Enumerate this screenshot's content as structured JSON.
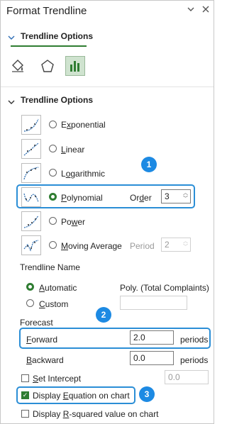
{
  "panel": {
    "title": "Format Trendline",
    "collapse_icon": "chevron-down-icon",
    "close_icon": "close-icon"
  },
  "tabs": {
    "active_label": "Trendline Options",
    "categories": [
      "fill-line-icon",
      "effects-pentagon-icon",
      "trendline-options-bar-icon"
    ]
  },
  "section": {
    "label": "Trendline Options"
  },
  "types": [
    {
      "label_pre": "",
      "label_u": "x",
      "label_post": "ponential",
      "icon": "exponential-curve-icon"
    },
    {
      "label_pre": "",
      "label_u": "L",
      "label_post": "inear",
      "icon": "linear-line-icon"
    },
    {
      "label_pre": "L",
      "label_u": "o",
      "label_post": "garithmic",
      "icon": "logarithmic-curve-icon"
    },
    {
      "label_pre": "",
      "label_u": "P",
      "label_post": "olynomial",
      "icon": "polynomial-curve-icon"
    },
    {
      "label_pre": "Po",
      "label_u": "w",
      "label_post": "er",
      "icon": "power-curve-icon"
    },
    {
      "label_pre": "",
      "label_u": "M",
      "label_post": "oving Average",
      "icon": "moving-average-icon"
    }
  ],
  "selected_type": "Polynomial",
  "order": {
    "label_pre": "Or",
    "label_u": "d",
    "label_post": "er",
    "value": "3"
  },
  "period": {
    "label": "Period",
    "value": "2"
  },
  "name": {
    "heading": "Trendline Name",
    "automatic": "Automatic",
    "automatic_value": "Poly. (Total Complaints)",
    "custom": "Custom",
    "custom_value": ""
  },
  "forecast": {
    "heading": "Forecast",
    "forward_label": "Forward",
    "forward_value": "2.0",
    "backward_label": "Backward",
    "backward_value": "0.0",
    "units": "periods"
  },
  "intercept": {
    "label": "Set Intercept",
    "value": "0.0",
    "checked": false
  },
  "display_equation": {
    "label_pre": "Display ",
    "label_u": "E",
    "label_post": "quation on chart",
    "checked": true
  },
  "display_r2": {
    "label_pre": "Display ",
    "label_u": "R",
    "label_post": "-squared value on chart",
    "checked": false
  },
  "callouts": [
    "1",
    "2",
    "3"
  ],
  "colors": {
    "accent_green": "#2f7d32",
    "highlight_blue": "#2b8ed6",
    "badge_blue": "#1d8ae3"
  }
}
